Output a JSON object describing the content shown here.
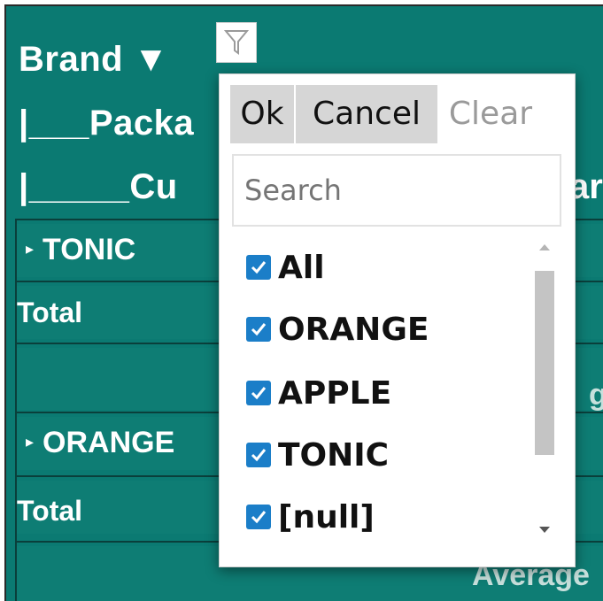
{
  "header": {
    "level1": "Brand ▼",
    "level2": "|___Packa",
    "level3": "|_____Cu",
    "level3_tail": "ar"
  },
  "rows": {
    "group1_label": "TONIC",
    "total1": "Total",
    "avg1": "ge",
    "group2_label": "ORANGE",
    "total2": "Total",
    "avg2": "Average"
  },
  "filter_popup": {
    "ok_label": "Ok",
    "cancel_label": "Cancel",
    "clear_label": "Clear",
    "search_placeholder": "Search",
    "items": [
      {
        "label": "All",
        "checked": true
      },
      {
        "label": "ORANGE",
        "checked": true
      },
      {
        "label": "APPLE",
        "checked": true
      },
      {
        "label": "TONIC",
        "checked": true
      },
      {
        "label": "[null]",
        "checked": true
      }
    ]
  },
  "colors": {
    "teal": "#0b7a72",
    "checkbox": "#1b7ec8"
  }
}
